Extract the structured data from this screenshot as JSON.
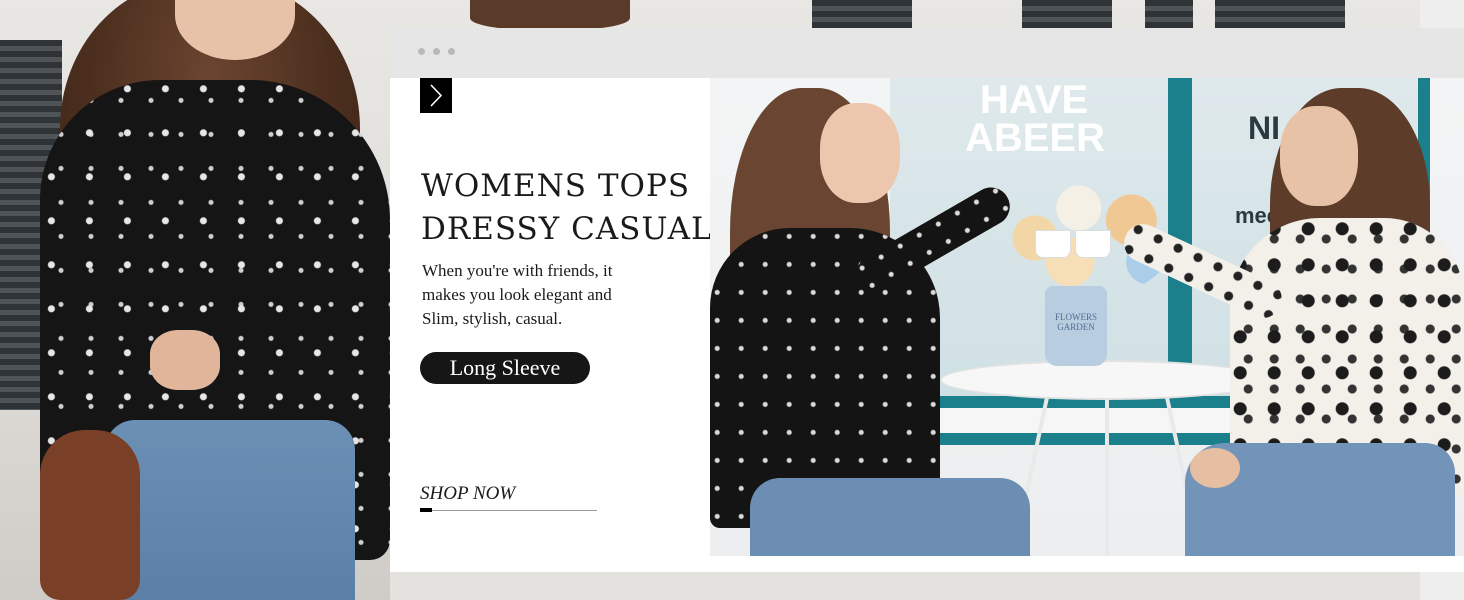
{
  "banner": {
    "window_dots": [
      "dot",
      "dot",
      "dot"
    ],
    "next_arrow_icon": "chevron-right-icon",
    "headline_line1": "WOMENS TOPS",
    "headline_line2": "DRESSY CASUAL",
    "description_line1": "When you're with friends, it",
    "description_line2": "makes you look elegant and",
    "description_line3": "Slim, stylish, casual.",
    "pill_label": "Long Sleeve",
    "cta_label": "SHOP NOW"
  },
  "photo": {
    "window_sign_1a": "HAVE",
    "window_sign_1b": "ABEER",
    "window_sign_2a": "NI",
    "window_sign_2b": "mee",
    "vase_label_1": "FLOWERS",
    "vase_label_2": "GARDEN"
  },
  "colors": {
    "background": "#ededed",
    "card": "#ffffff",
    "topbar": "#e6e6e6",
    "text": "#1a1a1a",
    "pill": "#161616",
    "accent_teal": "#1c7f8c"
  }
}
